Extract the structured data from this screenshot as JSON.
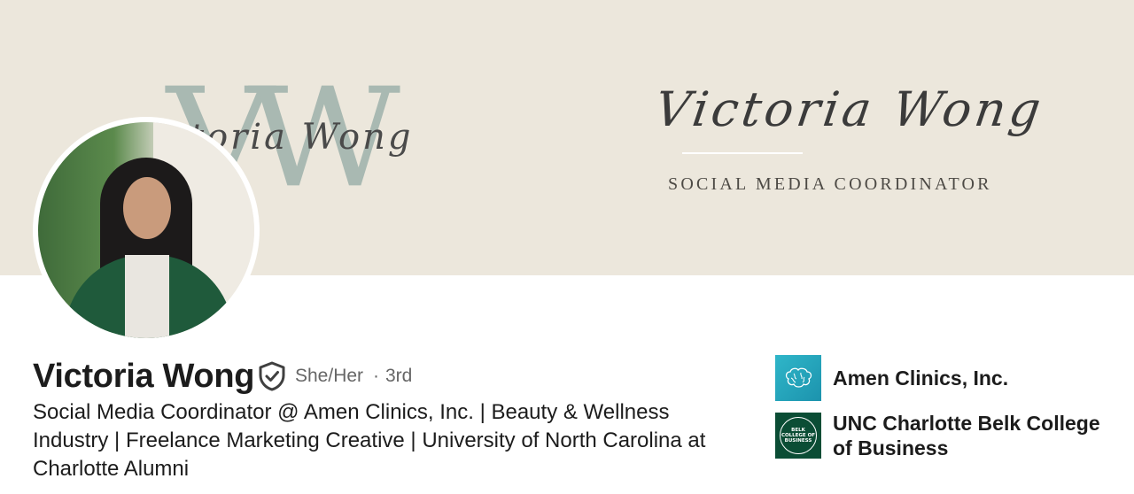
{
  "banner": {
    "monogram": "VW",
    "monogram_script": "toria Wong",
    "script_name": "Victoria Wong",
    "subtitle": "SOCIAL MEDIA COORDINATOR"
  },
  "profile": {
    "name": "Victoria Wong",
    "verified_icon": "shield-check-icon",
    "pronouns": "She/Her",
    "separator": "·",
    "degree": "3rd",
    "headline": "Social Media Coordinator @ Amen Clinics, Inc. | Beauty & Wellness Industry | Freelance Marketing Creative | University of North Carolina at Charlotte Alumni"
  },
  "companies": [
    {
      "label": "Amen Clinics, Inc.",
      "logo_icon": "brain-icon",
      "logo_color": "#2fb6c9"
    },
    {
      "label": "UNC Charlotte Belk College of Business",
      "logo_icon": "belk-college-seal-icon",
      "logo_color": "#0b4d35",
      "logo_text": "BELK COLLEGE OF BUSINESS"
    }
  ],
  "colors": {
    "banner_bg": "#ece7dc",
    "text_primary": "#1c1c1c",
    "text_secondary": "#666666"
  }
}
